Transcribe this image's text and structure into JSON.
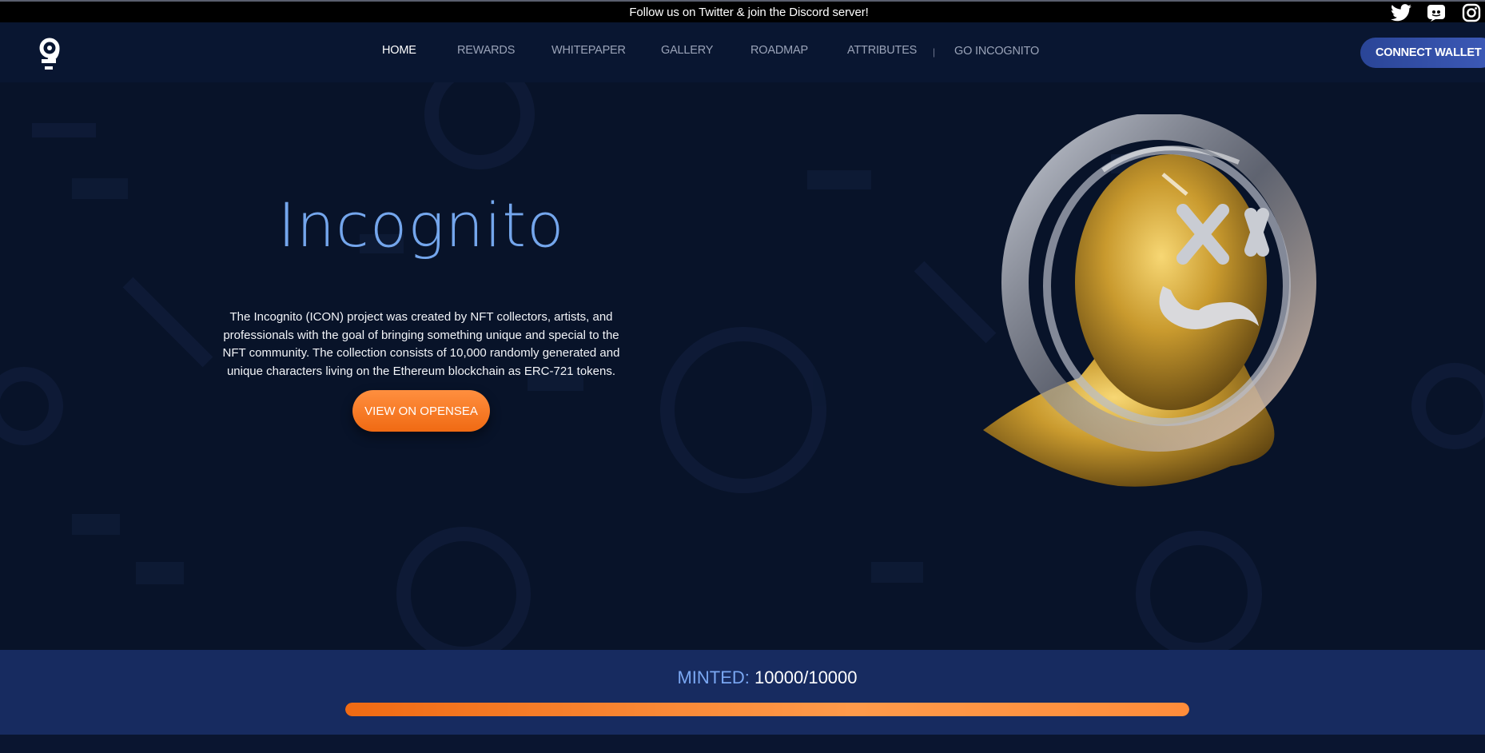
{
  "topbar": {
    "announcement": "Follow us on Twitter & join the Discord server!",
    "socials": [
      "twitter-icon",
      "discord-icon",
      "instagram-icon"
    ]
  },
  "nav": {
    "logo": "incognito-logo",
    "items": [
      {
        "label": "HOME",
        "active": true
      },
      {
        "label": "REWARDS"
      },
      {
        "label": "WHITEPAPER"
      },
      {
        "label": "GALLERY"
      },
      {
        "label": "ROADMAP"
      },
      {
        "label": "ATTRIBUTES"
      }
    ],
    "separator": "|",
    "go_incognito": "GO INCOGNITO",
    "connect_wallet": "CONNECT WALLET"
  },
  "hero": {
    "brand": "Incognito",
    "description": "The Incognito (ICON) project was created by NFT collectors, artists, and professionals with the goal of bringing something unique and special to the NFT community. The collection consists of 10,000 randomly generated and unique characters living on the Ethereum blockchain as ERC-721 tokens.",
    "cta": "VIEW ON OPENSEA"
  },
  "mint": {
    "label": "MINTED:",
    "value": "10000/10000",
    "progress": 1.0
  },
  "colors": {
    "accent_blue": "#74a6ec",
    "accent_orange": "#f06a13",
    "background": "#081329",
    "mint_band": "#172b60"
  }
}
